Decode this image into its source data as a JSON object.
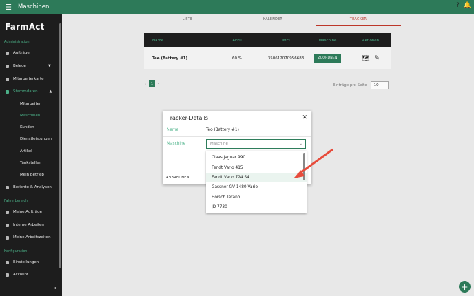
{
  "header": {
    "menu_icon": "hamburger-icon",
    "title": "Maschinen",
    "help_icon": "?",
    "bell_icon": "bell-icon"
  },
  "sidebar": {
    "logo": "FarmAct",
    "sections": {
      "administration": "Administration",
      "fahrerbereich": "Fahrerbereich",
      "konfiguration": "Konfiguration"
    },
    "items": {
      "auftraege": "Aufträge",
      "belege": "Belege",
      "mitarbeiterkarte": "Mitarbeiterkarte",
      "stammdaten": "Stammdaten",
      "berichte": "Berichte & Analysen",
      "meine_auftraege": "Meine Aufträge",
      "interne_arbeiten": "Interne Arbeiten",
      "meine_arbeitszeiten": "Meine Arbeitszeiten",
      "einstellungen": "Einstellungen",
      "account": "Account"
    },
    "subitems": [
      "Mitarbeiter",
      "Maschinen",
      "Kunden",
      "Dienstleistungen",
      "Artikel",
      "Tankstellen",
      "Mein Betrieb"
    ],
    "collapse_icon": "◂"
  },
  "tabs": [
    "LISTE",
    "KALENDER",
    "TRACKER"
  ],
  "table": {
    "headers": [
      "Name",
      "Akku",
      "IMEI",
      "Maschine",
      "Aktionen"
    ],
    "row": {
      "name": "Teo (Battery #1)",
      "akku": "60 %",
      "imei": "350612070956683",
      "assign_label": "ZUORDNEN"
    }
  },
  "pager": {
    "prev": "‹",
    "page": "1",
    "next": "›",
    "per_page_label": "Einträge pro Seite",
    "per_page_value": "10"
  },
  "dialog": {
    "title": "Tracker-Details",
    "close": "✕",
    "name_label": "Name",
    "name_value": "Teo (Battery #1)",
    "machine_label": "Maschine",
    "machine_placeholder": "Maschine",
    "cancel": "ABBRECHEN"
  },
  "dropdown": [
    "Claas Jaguar 990",
    "Fendt Vario 415",
    "Fendt Vario 724 S4",
    "Gassner GV 1480 Vario",
    "Horsch Terano",
    "JD 7730"
  ],
  "colors": {
    "primary": "#2e7d5b",
    "accent_green": "#4db38a",
    "sidebar": "#1e1e1e",
    "tab_active": "#c0392b",
    "arrow": "#e74c3c"
  },
  "fab": "+"
}
